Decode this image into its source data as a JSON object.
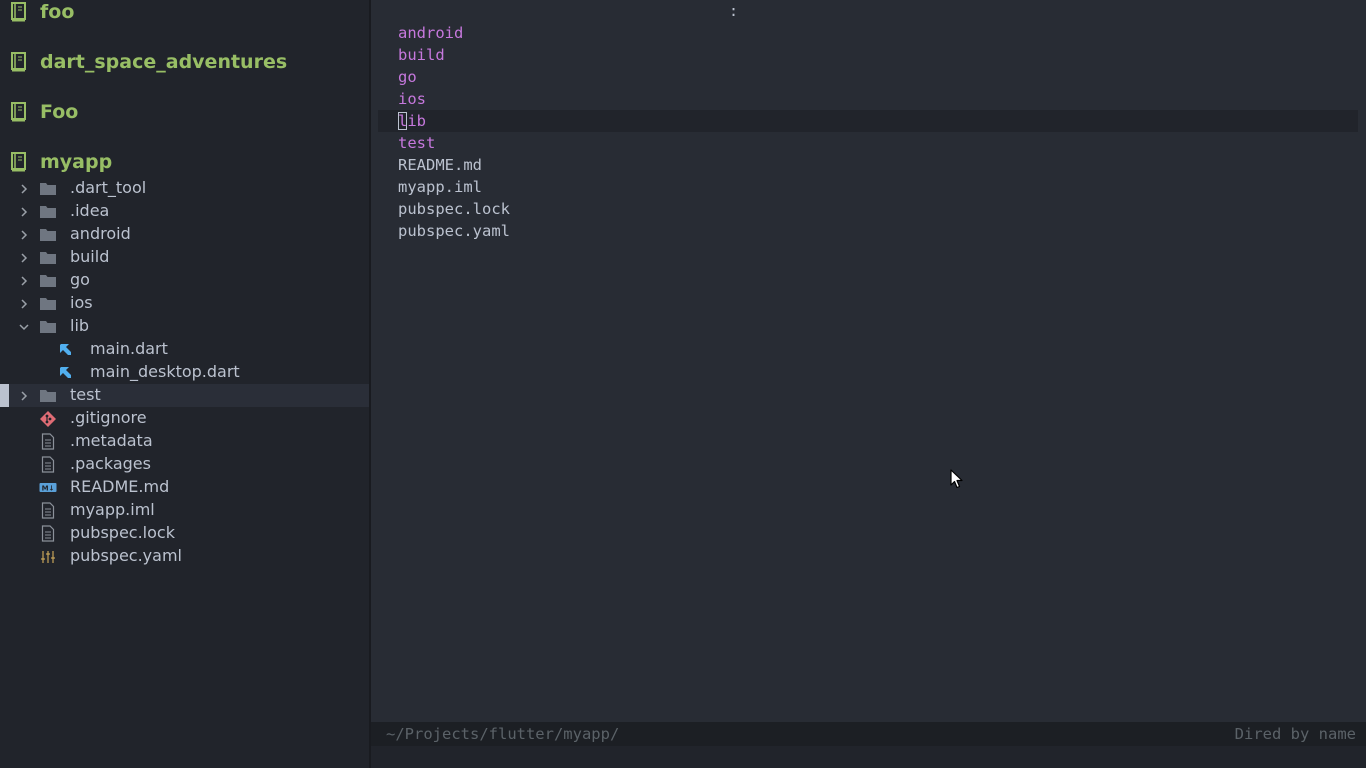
{
  "sidebar": {
    "projects": [
      {
        "name": "foo"
      },
      {
        "name": "dart_space_adventures"
      },
      {
        "name": "Foo"
      },
      {
        "name": "myapp"
      }
    ],
    "tree": [
      {
        "label": ".dart_tool",
        "icon": "folder-icon",
        "expandable": true,
        "expanded": false
      },
      {
        "label": ".idea",
        "icon": "folder-icon",
        "expandable": true,
        "expanded": false
      },
      {
        "label": "android",
        "icon": "folder-icon",
        "expandable": true,
        "expanded": false
      },
      {
        "label": "build",
        "icon": "folder-icon",
        "expandable": true,
        "expanded": false
      },
      {
        "label": "go",
        "icon": "folder-icon",
        "expandable": true,
        "expanded": false
      },
      {
        "label": "ios",
        "icon": "folder-icon",
        "expandable": true,
        "expanded": false
      },
      {
        "label": "lib",
        "icon": "folder-icon",
        "expandable": true,
        "expanded": true
      },
      {
        "label": "main.dart",
        "icon": "dart-icon",
        "expandable": false
      },
      {
        "label": "main_desktop.dart",
        "icon": "dart-icon",
        "expandable": false
      },
      {
        "label": "test",
        "icon": "folder-icon",
        "expandable": true,
        "expanded": false,
        "selected": true
      },
      {
        "label": ".gitignore",
        "icon": "git-icon",
        "expandable": false
      },
      {
        "label": ".metadata",
        "icon": "file-icon",
        "expandable": false
      },
      {
        "label": ".packages",
        "icon": "file-icon",
        "expandable": false
      },
      {
        "label": "README.md",
        "icon": "markdown-icon",
        "expandable": false
      },
      {
        "label": "myapp.iml",
        "icon": "file-icon",
        "expandable": false
      },
      {
        "label": "pubspec.lock",
        "icon": "file-icon",
        "expandable": false
      },
      {
        "label": "pubspec.yaml",
        "icon": "config-icon",
        "expandable": false
      }
    ]
  },
  "dired": {
    "header_mark": ":",
    "entries": [
      {
        "name": "android",
        "type": "dir"
      },
      {
        "name": "build",
        "type": "dir"
      },
      {
        "name": "go",
        "type": "dir"
      },
      {
        "name": "ios",
        "type": "dir"
      },
      {
        "name": "lib",
        "type": "dir",
        "current": true
      },
      {
        "name": "test",
        "type": "dir"
      },
      {
        "name": "README.md",
        "type": "file"
      },
      {
        "name": "myapp.iml",
        "type": "file"
      },
      {
        "name": "pubspec.lock",
        "type": "file"
      },
      {
        "name": "pubspec.yaml",
        "type": "file"
      }
    ]
  },
  "modeline": {
    "path": "~/Projects/flutter/myapp/",
    "mode": "Dired by name"
  },
  "colors": {
    "project": "#98be65",
    "directory": "#c678dd",
    "text": "#bbc2cf",
    "folder": "#6f7681",
    "dart": "#51afef",
    "git": "#e06c75",
    "yaml": "#c8a55a"
  }
}
